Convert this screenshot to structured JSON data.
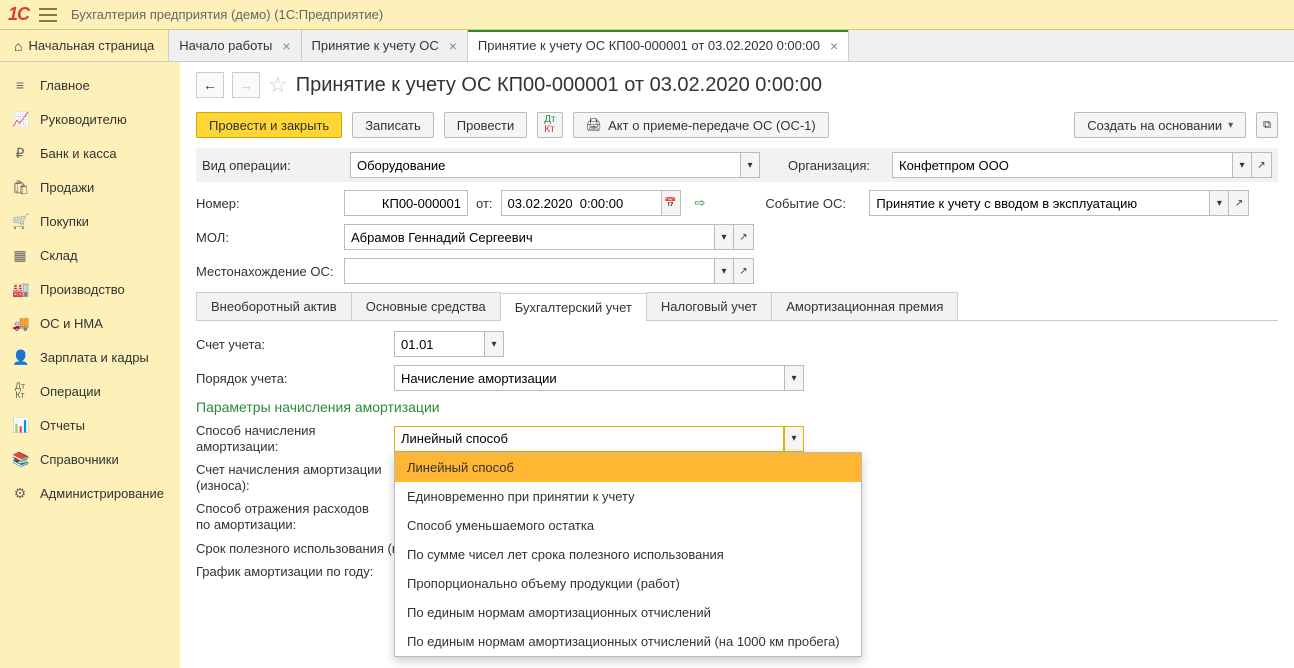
{
  "header": {
    "logo_text": "1C",
    "app_title": "Бухгалтерия предприятия (демо)  (1С:Предприятие)"
  },
  "tabs": {
    "home": "Начальная страница",
    "items": [
      {
        "label": "Начало работы"
      },
      {
        "label": "Принятие к учету ОС"
      },
      {
        "label": "Принятие к учету ОС КП00-000001 от 03.02.2020 0:00:00",
        "active": true
      }
    ]
  },
  "sidebar": [
    {
      "icon": "≡",
      "label": "Главное"
    },
    {
      "icon": "📈",
      "label": "Руководителю"
    },
    {
      "icon": "₽",
      "label": "Банк и касса"
    },
    {
      "icon": "🛍",
      "label": "Продажи"
    },
    {
      "icon": "🛒",
      "label": "Покупки"
    },
    {
      "icon": "▦",
      "label": "Склад"
    },
    {
      "icon": "🏭",
      "label": "Производство"
    },
    {
      "icon": "🚚",
      "label": "ОС и НМА"
    },
    {
      "icon": "👤",
      "label": "Зарплата и кадры"
    },
    {
      "icon": "Дт",
      "label": "Операции"
    },
    {
      "icon": "📊",
      "label": "Отчеты"
    },
    {
      "icon": "📚",
      "label": "Справочники"
    },
    {
      "icon": "⚙",
      "label": "Администрирование"
    }
  ],
  "page": {
    "title": "Принятие к учету ОС КП00-000001 от 03.02.2020 0:00:00"
  },
  "toolbar": {
    "post_close": "Провести и закрыть",
    "save": "Записать",
    "post": "Провести",
    "print_act": "Акт о приеме-передаче ОС (ОС-1)",
    "create_based": "Создать на основании"
  },
  "form": {
    "op_type_label": "Вид операции:",
    "op_type_value": "Оборудование",
    "org_label": "Организация:",
    "org_value": "Конфетпром ООО",
    "number_label": "Номер:",
    "number_value": "КП00-000001",
    "from_label": "от:",
    "date_value": "03.02.2020  0:00:00",
    "event_label": "Событие ОС:",
    "event_value": "Принятие к учету с вводом в эксплуатацию",
    "mol_label": "МОЛ:",
    "mol_value": "Абрамов Геннадий Сергеевич",
    "location_label": "Местонахождение ОС:",
    "location_value": ""
  },
  "subtabs": [
    "Внеоборотный актив",
    "Основные средства",
    "Бухгалтерский учет",
    "Налоговый учет",
    "Амортизационная премия"
  ],
  "subtab_active": 2,
  "accounting": {
    "account_label": "Счет учета:",
    "account_value": "01.01",
    "order_label": "Порядок учета:",
    "order_value": "Начисление амортизации",
    "group_title": "Параметры начисления амортизации",
    "method_label": "Способ начисления амортизации:",
    "method_value": "Линейный способ",
    "method_options": [
      "Линейный способ",
      "Единовременно при принятии к учету",
      "Способ уменьшаемого остатка",
      "По сумме чисел лет срока полезного использования",
      "Пропорционально объему продукции (работ)",
      "По единым нормам амортизационных отчислений",
      "По единым нормам амортизационных отчислений (на 1000 км пробега)"
    ],
    "depr_account_label": "Счет начисления амортизации (износа):",
    "expense_method_label": "Способ отражения расходов по амортизации:",
    "useful_life_label": "Срок полезного использования (в месяцах):",
    "schedule_label": "График амортизации по году:"
  }
}
